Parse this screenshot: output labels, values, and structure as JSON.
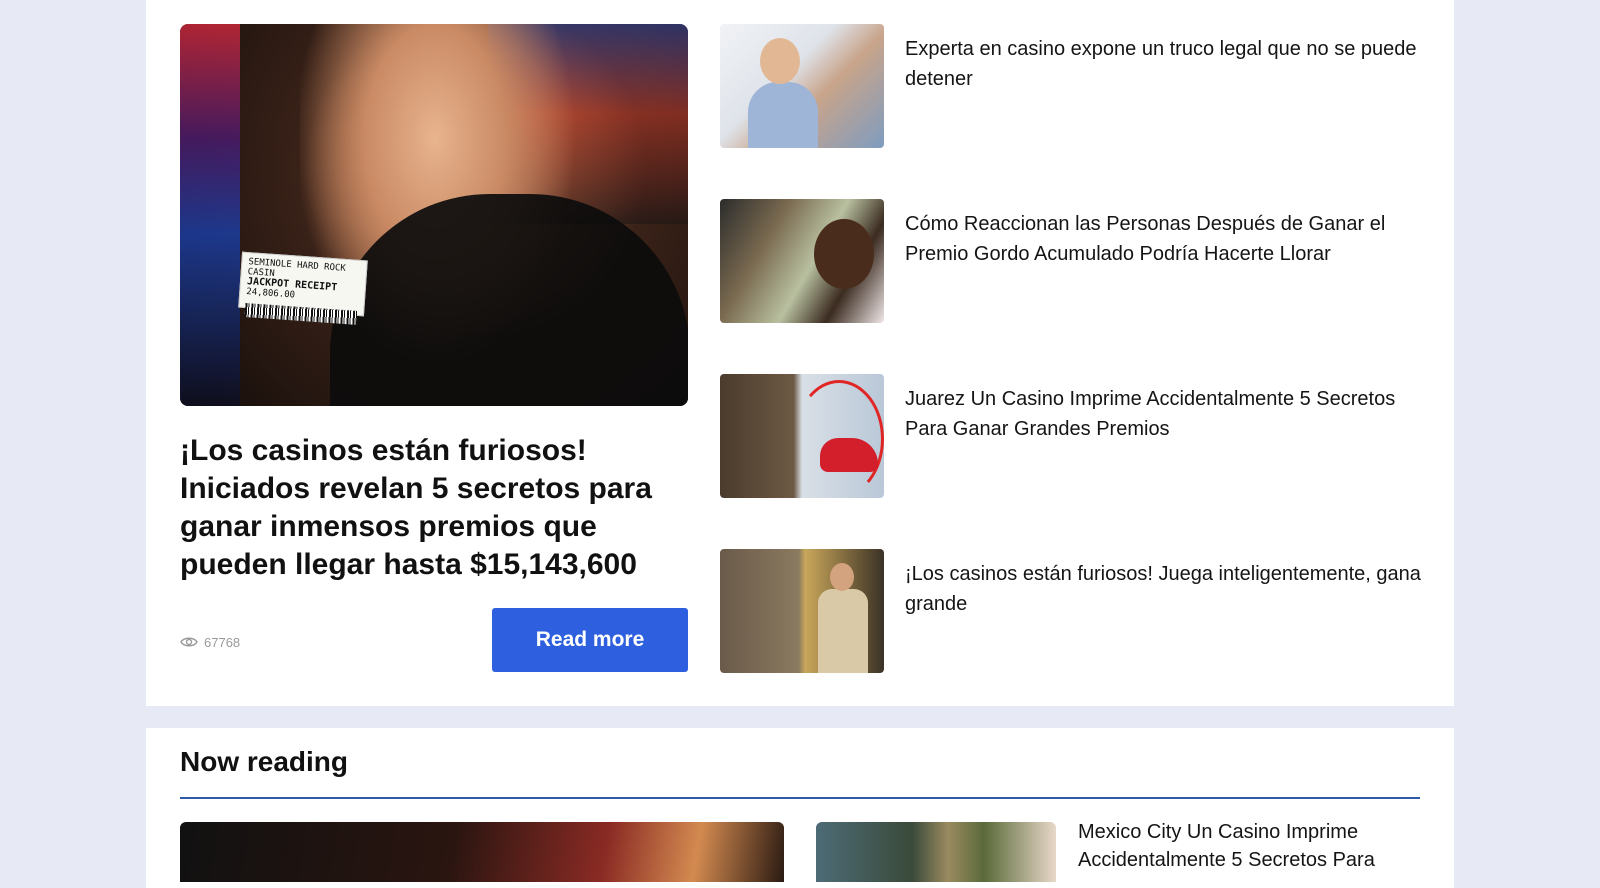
{
  "featured": {
    "image_alt": "Woman holding jackpot receipt giving thumbs up",
    "ticket_line1": "SEMINOLE HARD ROCK CASIN",
    "ticket_line2": "JACKPOT RECEIPT",
    "ticket_line3": "24,806.00",
    "title": "¡Los casinos están furiosos! Iniciados revelan 5 secretos para ganar inmensos premios que pueden llegar hasta $15,143,600",
    "views": "67768",
    "read_more_label": "Read more"
  },
  "side_articles": [
    {
      "title": "Experta en casino expone un truco legal que no se puede detener",
      "thumb_icon": "woman-on-phone-icon"
    },
    {
      "title": "Cómo Reaccionan las Personas Después de Ganar el Premio Gordo Acumulado Podría Hacerte Llorar",
      "thumb_icon": "man-with-cash-icon"
    },
    {
      "title": "Juarez Un Casino Imprime Accidentalmente 5 Secretos Para Ganar Grandes Premios",
      "thumb_icon": "man-and-red-car-icon"
    },
    {
      "title": "¡Los casinos están furiosos! Juega inteligentemente, gana grande",
      "thumb_icon": "homeless-to-rich-icon"
    }
  ],
  "now_reading": {
    "heading": "Now reading",
    "article_title": "Mexico City Un Casino Imprime Accidentalmente 5 Secretos Para"
  },
  "colors": {
    "accent": "#2e5fde",
    "rule": "#2e5aa8",
    "page_bg": "#e7e9f5",
    "views_text": "#9a9a9a"
  }
}
